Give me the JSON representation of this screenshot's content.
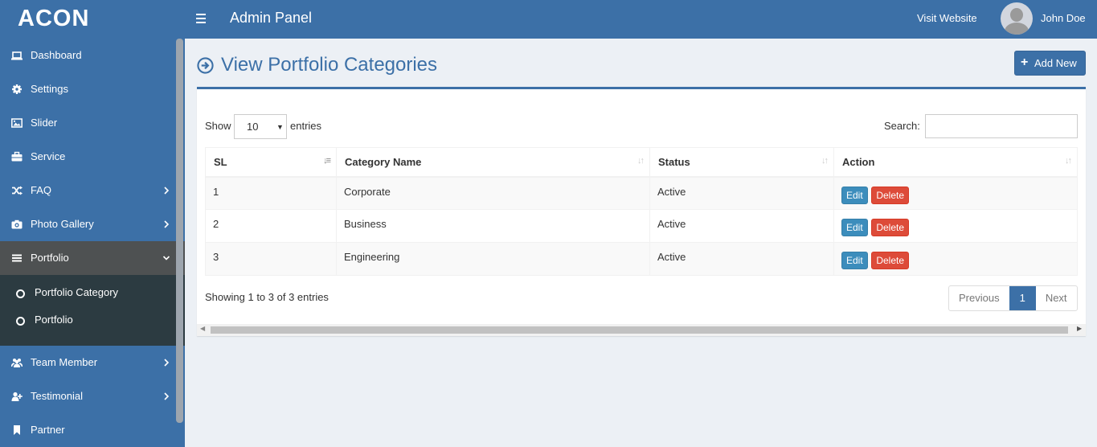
{
  "header": {
    "logo": "ACON",
    "panel_title": "Admin Panel",
    "visit_website": "Visit Website",
    "user_name": "John Doe"
  },
  "sidebar": {
    "items": [
      {
        "label": "Dashboard",
        "icon": "laptop-icon"
      },
      {
        "label": "Settings",
        "icon": "gear-icon"
      },
      {
        "label": "Slider",
        "icon": "image-icon"
      },
      {
        "label": "Service",
        "icon": "briefcase-icon"
      },
      {
        "label": "FAQ",
        "icon": "shuffle-icon"
      },
      {
        "label": "Photo Gallery",
        "icon": "camera-icon"
      },
      {
        "label": "Portfolio",
        "icon": "bars-icon"
      },
      {
        "label": "Team Member",
        "icon": "users-icon"
      },
      {
        "label": "Testimonial",
        "icon": "user-plus-icon"
      },
      {
        "label": "Partner",
        "icon": "bookmark-icon"
      }
    ],
    "submenu": [
      {
        "label": "Portfolio Category"
      },
      {
        "label": "Portfolio"
      }
    ]
  },
  "page": {
    "title": "View Portfolio Categories",
    "add_new": "Add New"
  },
  "table_controls": {
    "show_label": "Show",
    "page_length": "10",
    "entries_label": "entries",
    "search_label": "Search:",
    "search_value": ""
  },
  "table": {
    "columns": [
      "SL",
      "Category Name",
      "Status",
      "Action"
    ],
    "rows": [
      {
        "sl": "1",
        "name": "Corporate",
        "status": "Active",
        "edit": "Edit",
        "delete": "Delete"
      },
      {
        "sl": "2",
        "name": "Business",
        "status": "Active",
        "edit": "Edit",
        "delete": "Delete"
      },
      {
        "sl": "3",
        "name": "Engineering",
        "status": "Active",
        "edit": "Edit",
        "delete": "Delete"
      }
    ]
  },
  "footer": {
    "info": "Showing 1 to 3 of 3 entries",
    "previous": "Previous",
    "current_page": "1",
    "next": "Next"
  },
  "colors": {
    "brand": "#3c70a7",
    "edit": "#3c8dbc",
    "delete": "#dd4b39",
    "active_menu": "#4e5152",
    "submenu_bg": "#2c3b41"
  }
}
